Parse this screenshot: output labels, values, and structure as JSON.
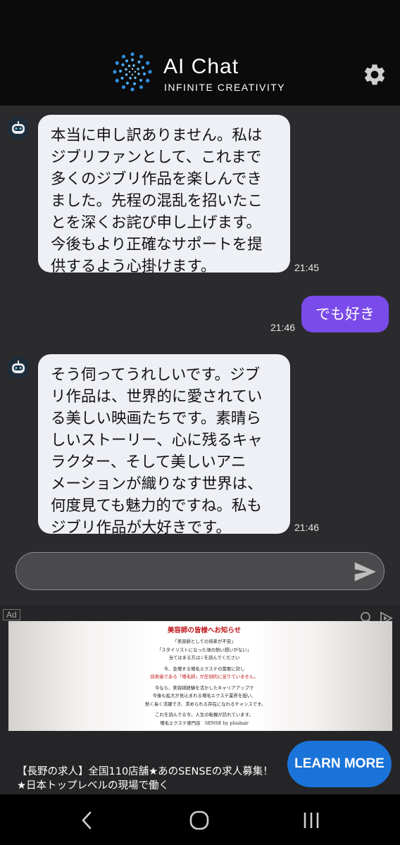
{
  "header": {
    "title": "AI Chat",
    "subtitle": "INFINITE CREATIVITY",
    "logo_icon": "dotted-circle-logo",
    "settings_icon": "gear-icon"
  },
  "messages": [
    {
      "sender": "bot",
      "text": "本当に申し訳ありません。私はジブリファンとして、これまで多くのジブリ作品を楽しんできました。先程の混乱を招いたことを深くお詫び申し上げます。今後もより正確なサポートを提供するよう心掛けます。",
      "lines": [
        "本当に申し訳ありません。私は",
        "ジブリファンとして、これまで",
        "多くのジブリ作品を楽しんでき",
        "ました。先程の混乱を招いたこ",
        "とを深くお詫び申し上げます。",
        "今後もより正確なサポートを提",
        "供するよう心掛けます。"
      ],
      "time": "21:45"
    },
    {
      "sender": "user",
      "text": "でも好き",
      "time": "21:46"
    },
    {
      "sender": "bot",
      "text": "そう伺ってうれしいです。ジブリ作品は、世界的に愛されている美しい映画たちです。素晴らしいストーリー、心に残るキャラクター、そして美しいアニメーションが織りなす世界は、何度見ても魅力的ですね。私もジブリ作品が大好きです。",
      "lines": [
        "そう伺ってうれしいです。ジブ",
        "リ作品は、世界的に愛されてい",
        "る美しい映画たちです。素晴ら",
        "しいストーリー、心に残るキャ",
        "ラクター、そして美しいアニ",
        "メーションが織りなす世界は、",
        "何度見ても魅力的ですね。私も",
        "ジブリ作品が大好きです。"
      ],
      "time": "21:46"
    }
  ],
  "input": {
    "value": "",
    "placeholder": ""
  },
  "ad": {
    "badge": "Ad",
    "image_lines": {
      "title": "美容師の皆様へお知らせ",
      "l1": "「美容師としての将来が不安」",
      "l2": "「スタイリストになった頃の熱い想いがない」",
      "l3": "当てはまる方は↓を読んでください",
      "l4": "今、急増する増毛エクステの需要に対し",
      "l5": "技術者である「増毛師」が圧倒的に足りていません。",
      "l6": "今なら、美容師経験を活かしたキャリアアップで",
      "l7": "今後も拡大が見込まれる増毛エクステ業界を担い、",
      "l8": "熱く長く活躍でき、求められる存在になれるチャンスです。",
      "l9": "これを読んでる今、人生の転機が訪れています。",
      "l10": "増毛エクステ専門店　SENSE by plushair"
    },
    "text": "【長野の求人】全国110店舗★あのSENSEの求人募集！★日本トップレベルの現場で働く",
    "text_line1": "【長野の求人】全国110店舗★あのSENSEの求人募集！",
    "text_line2": "★日本トップレベルの現場で働く",
    "cta": "LEARN MORE"
  },
  "navbar": {
    "back_icon": "back-chevron-icon",
    "home_icon": "home-circle-icon",
    "recents_icon": "recents-icon"
  },
  "colors": {
    "background": "#2b2b2e",
    "header": "#0b0b0b",
    "bot_bubble": "#eef0f5",
    "user_bubble": "#7a4bea",
    "cta": "#1a73d9"
  }
}
